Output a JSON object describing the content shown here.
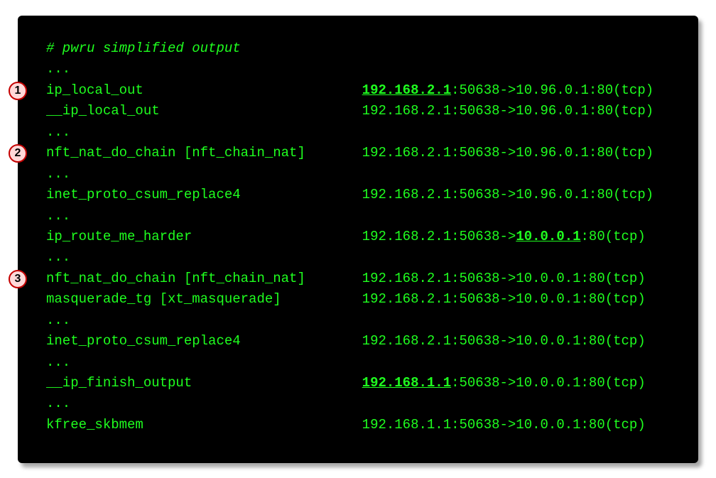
{
  "terminal": {
    "comment": "# pwru simplified output",
    "rows": [
      {
        "type": "ellipsis",
        "text": "..."
      },
      {
        "type": "trace",
        "fn": "ip_local_out",
        "tuple": {
          "pref": "",
          "emA": "192.168.2.1",
          "mid": ":50638->10.96.0.1:80(tcp)",
          "emB": "",
          "suf": ""
        }
      },
      {
        "type": "trace",
        "fn": "__ip_local_out",
        "tuple": {
          "pref": "192.168.2.1:50638->10.96.0.1:80(tcp)",
          "emA": "",
          "mid": "",
          "emB": "",
          "suf": ""
        }
      },
      {
        "type": "ellipsis",
        "text": "..."
      },
      {
        "type": "trace",
        "fn": "nft_nat_do_chain [nft_chain_nat]",
        "tuple": {
          "pref": "192.168.2.1:50638->10.96.0.1:80(tcp)",
          "emA": "",
          "mid": "",
          "emB": "",
          "suf": ""
        }
      },
      {
        "type": "ellipsis",
        "text": "..."
      },
      {
        "type": "trace",
        "fn": "inet_proto_csum_replace4",
        "tuple": {
          "pref": "192.168.2.1:50638->10.96.0.1:80(tcp)",
          "emA": "",
          "mid": "",
          "emB": "",
          "suf": ""
        }
      },
      {
        "type": "ellipsis",
        "text": "..."
      },
      {
        "type": "trace",
        "fn": "ip_route_me_harder",
        "tuple": {
          "pref": "192.168.2.1:50638->",
          "emA": "10.0.0.1",
          "mid": ":80(tcp)",
          "emB": "",
          "suf": ""
        }
      },
      {
        "type": "ellipsis",
        "text": "..."
      },
      {
        "type": "trace",
        "fn": "nft_nat_do_chain [nft_chain_nat]",
        "tuple": {
          "pref": "192.168.2.1:50638->10.0.0.1:80(tcp)",
          "emA": "",
          "mid": "",
          "emB": "",
          "suf": ""
        }
      },
      {
        "type": "trace",
        "fn": "masquerade_tg [xt_masquerade]",
        "tuple": {
          "pref": "192.168.2.1:50638->10.0.0.1:80(tcp)",
          "emA": "",
          "mid": "",
          "emB": "",
          "suf": ""
        }
      },
      {
        "type": "ellipsis",
        "text": "..."
      },
      {
        "type": "trace",
        "fn": "inet_proto_csum_replace4",
        "tuple": {
          "pref": "192.168.2.1:50638->10.0.0.1:80(tcp)",
          "emA": "",
          "mid": "",
          "emB": "",
          "suf": ""
        }
      },
      {
        "type": "ellipsis",
        "text": "..."
      },
      {
        "type": "trace",
        "fn": "__ip_finish_output",
        "tuple": {
          "pref": "",
          "emA": "192.168.1.1",
          "mid": ":50638->10.0.0.1:80(tcp)",
          "emB": "",
          "suf": ""
        }
      },
      {
        "type": "ellipsis",
        "text": "..."
      },
      {
        "type": "trace",
        "fn": "kfree_skbmem",
        "tuple": {
          "pref": "192.168.1.1:50638->10.0.0.1:80(tcp)",
          "emA": "",
          "mid": "",
          "emB": "",
          "suf": ""
        }
      }
    ]
  },
  "annotations": [
    {
      "label": "1",
      "row_index": 1
    },
    {
      "label": "2",
      "row_index": 4
    },
    {
      "label": "3",
      "row_index": 10
    }
  ]
}
